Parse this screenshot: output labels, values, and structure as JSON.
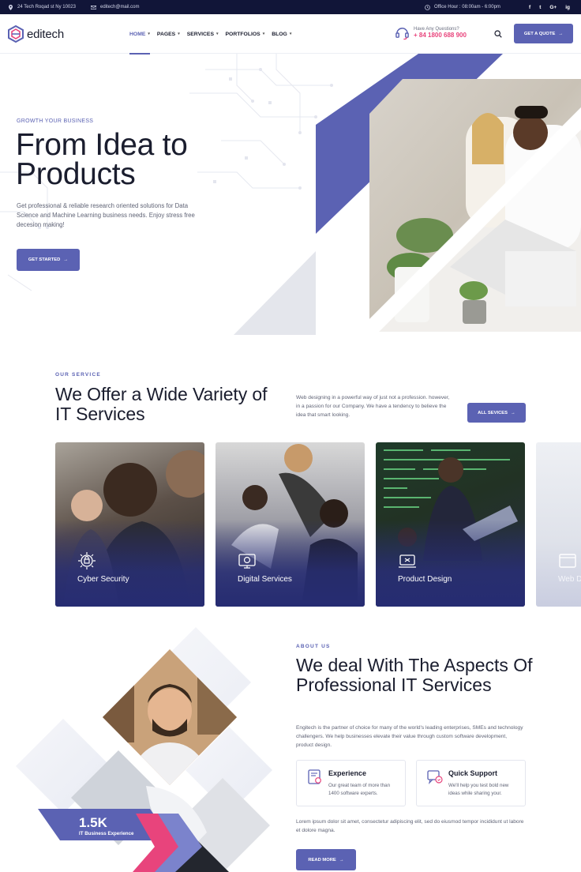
{
  "topbar": {
    "address": "24 Tech Roqad st Ny 10023",
    "email": "editech@mail.com",
    "office_hours": "Office Hour : 08:00am - 6:00pm",
    "social": [
      "f",
      "t",
      "G+",
      "ig"
    ]
  },
  "header": {
    "logo": "editech",
    "nav": [
      {
        "label": "HOME"
      },
      {
        "label": "PAGES"
      },
      {
        "label": "SERVICES"
      },
      {
        "label": "PORTFOLIOS"
      },
      {
        "label": "BLOG"
      }
    ],
    "phone_question": "Have Any Questions?",
    "phone_number": "+ 84 1800 688 900",
    "quote_button": "GET A QUOTE"
  },
  "hero": {
    "eyebrow": "GROWTH YOUR BUSINESS",
    "title": "From Idea to Products",
    "text": "Get professional & reliable research oriented solutions for Data Science and Machine Learning business needs. Enjoy stress free decesion making!",
    "button": "GET STARTED"
  },
  "services": {
    "eyebrow": "OUR SERVICE",
    "title": "We Offer a Wide Variety of IT Services",
    "description": "Web designing in a powerful way of just not a profession. however, in a passion for our Company. We have a tendency to believe the idea that smart looking.",
    "button": "ALL SEVICES",
    "cards": [
      {
        "title": "Cyber Security",
        "icon": "security-icon"
      },
      {
        "title": "Digital Services",
        "icon": "digital-icon"
      },
      {
        "title": "Product Design",
        "icon": "design-icon"
      },
      {
        "title": "Web D",
        "icon": "web-icon"
      }
    ]
  },
  "about": {
    "eyebrow": "ABOUT US",
    "title": "We deal With The Aspects Of Professional IT Services",
    "text": "Engitech is the partner of choice for many of the world's leading enterprises, SMEs and technology challengers. We help businesses elevate their value through custom software development, product design.",
    "features": [
      {
        "title": "Experience",
        "text": "Our great team of more than 1400 software experts."
      },
      {
        "title": "Quick Support",
        "text": "We'll help you test bold new ideas while sharing your."
      }
    ],
    "lorem": "Lorem ipsum dolor sit amet, consectetur adipiscing elit, sed do eiusmod tempor incididunt ut labore et dolore magna.",
    "button": "READ MORE",
    "stat_number": "1.5K",
    "stat_label": "IT Business Experience"
  },
  "colors": {
    "primary": "#5b62b3",
    "dark": "#111538",
    "accent_pink": "#e8447c"
  }
}
